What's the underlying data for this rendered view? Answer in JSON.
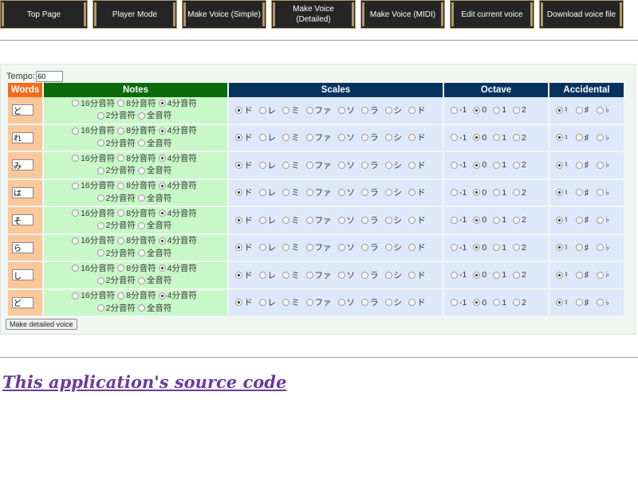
{
  "nav": [
    {
      "label": "Top Page"
    },
    {
      "label": "Player Mode"
    },
    {
      "label": "Make Voice (Simple)"
    },
    {
      "label": "Make Voice\n(Detailed)"
    },
    {
      "label": "Make Voice (MIDI)"
    },
    {
      "label": "Edit current voice"
    },
    {
      "label": "Download voice file"
    }
  ],
  "form": {
    "tempo_label": "Tempo:",
    "tempo_value": "60",
    "headers": {
      "words": "Words",
      "notes": "Notes",
      "scales": "Scales",
      "octave": "Octave",
      "accidental": "Accidental"
    },
    "note_options": [
      "16分音符",
      "8分音符",
      "4分音符",
      "2分音符",
      "全音符"
    ],
    "scale_options": [
      "ド",
      "レ",
      "ミ",
      "ファ",
      "ソ",
      "ラ",
      "シ",
      "ド"
    ],
    "octave_options": [
      "-1",
      "0",
      "1",
      "2"
    ],
    "accidental_options": [
      "♮",
      "♯",
      "♭"
    ],
    "rows": [
      {
        "word": "ど",
        "note": 2,
        "scale": 0,
        "octave": 1,
        "accidental": 0
      },
      {
        "word": "れ",
        "note": 2,
        "scale": 0,
        "octave": 1,
        "accidental": 0
      },
      {
        "word": "み",
        "note": 2,
        "scale": 0,
        "octave": 1,
        "accidental": 0
      },
      {
        "word": "は",
        "note": 2,
        "scale": 0,
        "octave": 1,
        "accidental": 0
      },
      {
        "word": "そ",
        "note": 2,
        "scale": 0,
        "octave": 1,
        "accidental": 0
      },
      {
        "word": "ら",
        "note": 2,
        "scale": 0,
        "octave": 1,
        "accidental": 0
      },
      {
        "word": "し",
        "note": 2,
        "scale": 0,
        "octave": 1,
        "accidental": 0
      },
      {
        "word": "ど",
        "note": 2,
        "scale": 0,
        "octave": 1,
        "accidental": 0
      }
    ],
    "submit_label": "Make detailed voice"
  },
  "source_link": "This application's source code",
  "colors": {
    "nav_bg": "#252525",
    "nav_border": "#b09868",
    "words_header": "#f26c1e",
    "notes_header": "#0a6b0a",
    "scales_header": "#08325e",
    "words_cell": "#fcc79a",
    "notes_cell": "#c8f7c8",
    "scales_cell": "#dde9fa",
    "link": "#6b3aa0"
  }
}
